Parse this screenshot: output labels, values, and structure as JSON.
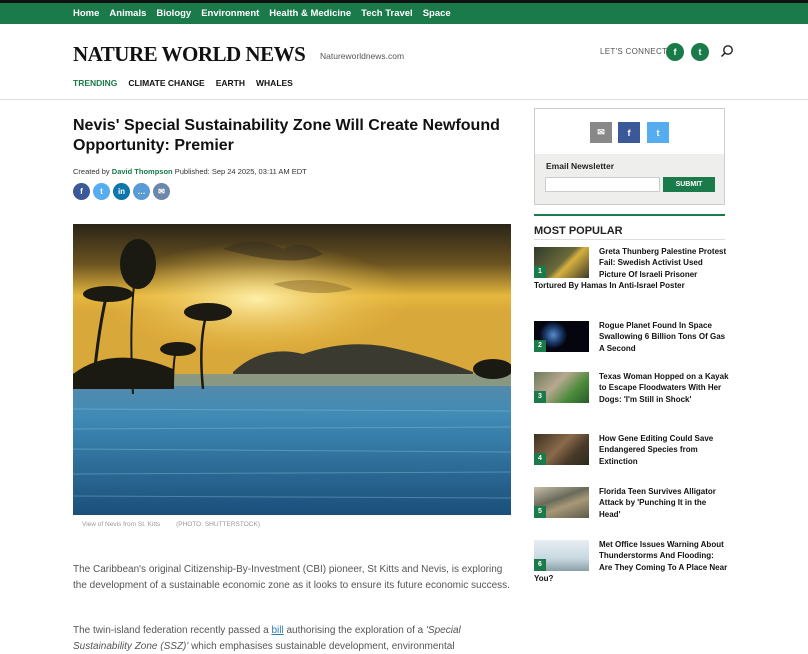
{
  "nav": {
    "items": [
      "Home",
      "Animals",
      "Biology",
      "Environment",
      "Health & Medicine",
      "Tech Travel",
      "Space"
    ]
  },
  "header": {
    "logo": "NATURE WORLD NEWS",
    "domain": "Natureworldnews.com",
    "connect_label": "LET'S CONNECT",
    "facebook_glyph": "f",
    "twitter_glyph": "t"
  },
  "topics": [
    "TRENDING",
    "CLIMATE CHANGE",
    "EARTH",
    "WHALES"
  ],
  "article": {
    "title": "Nevis' Special Sustainability Zone Will Create Newfound Opportunity: Premier",
    "created_by_label": "Created by",
    "author": "David Thompson",
    "published": "Published: Sep 24 2025, 03:11 AM EDT",
    "caption": "View of Nevis from St. Kitts",
    "photo_credit": "(PHOTO: SHUTTERSTOCK)",
    "para1": "The Caribbean's original Citizenship-By-Investment (CBI) pioneer, St Kitts and Nevis, is exploring the development of a sustainable economic zone as it looks to ensure its future economic success.",
    "para2_start": "The twin-island federation recently passed a ",
    "para2_link": "bill",
    "para2_mid": " authorising the exploration of a ",
    "para2_italic": "'Special Sustainability Zone (SSZ)'",
    "para2_end": " which emphasises sustainable development, environmental"
  },
  "share": {
    "facebook": "f",
    "twitter": "t",
    "linkedin": "in",
    "comment": "…",
    "email": "✉"
  },
  "newsletter": {
    "label": "Email Newsletter",
    "button": "SUBMIT",
    "email_glyph": "✉",
    "facebook_glyph": "f",
    "twitter_glyph": "t"
  },
  "most_popular": {
    "heading": "MOST POPULAR",
    "items": [
      {
        "num": "1",
        "title": "Greta Thunberg Palestine Protest Fail: Swedish Activist Used Picture Of Israeli Prisoner Tortured By Hamas In Anti-Israel Poster"
      },
      {
        "num": "2",
        "title": "Rogue Planet Found In Space Swallowing 6 Billion Tons Of Gas A Second"
      },
      {
        "num": "3",
        "title": "Texas Woman Hopped on a Kayak to Escape Floodwaters With Her Dogs: 'I'm Still in Shock'"
      },
      {
        "num": "4",
        "title": "How Gene Editing Could Save Endangered Species from Extinction"
      },
      {
        "num": "5",
        "title": "Florida Teen Survives Alligator Attack by 'Punching It in the Head'"
      },
      {
        "num": "6",
        "title": "Met Office Issues Warning About Thunderstorms And Flooding: Are They Coming To A Place Near You?"
      }
    ]
  },
  "colors": {
    "brand": "#1a7a4a",
    "link": "#2a7ab8",
    "facebook": "#3b5998",
    "twitter": "#55acee",
    "linkedin": "#0e76a8",
    "comment": "#5b9bd5",
    "email": "#6d87a8"
  }
}
